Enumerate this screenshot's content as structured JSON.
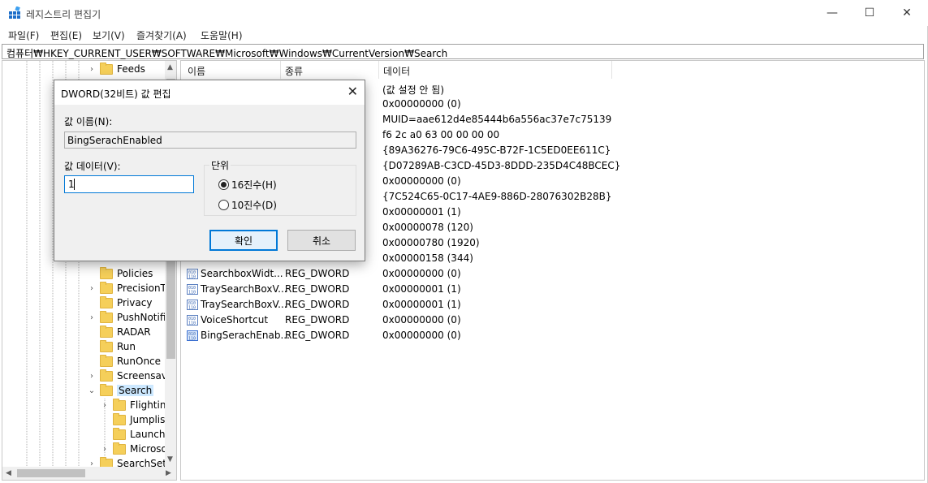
{
  "window": {
    "title": "레지스트리 편집기",
    "controls": {
      "minimize": "—",
      "maximize": "☐",
      "close": "✕"
    }
  },
  "menu": [
    "파일(F)",
    "편집(E)",
    "보기(V)",
    "즐겨찾기(A)",
    "도움말(H)"
  ],
  "address": "컴퓨터₩HKEY_CURRENT_USER₩SOFTWARE₩Microsoft₩Windows₩CurrentVersion₩Search",
  "tree": {
    "items": [
      {
        "label": "Feeds",
        "expander": "›"
      },
      {
        "label": "Policies",
        "expander": ""
      },
      {
        "label": "PrecisionTc",
        "expander": "›"
      },
      {
        "label": "Privacy",
        "expander": ""
      },
      {
        "label": "PushNotific",
        "expander": "›"
      },
      {
        "label": "RADAR",
        "expander": ""
      },
      {
        "label": "Run",
        "expander": ""
      },
      {
        "label": "RunOnce",
        "expander": ""
      },
      {
        "label": "Screensave",
        "expander": "›"
      },
      {
        "label": "Search",
        "expander": "⌄"
      },
      {
        "label": "Flighting",
        "expander": "›"
      },
      {
        "label": "Jumplist",
        "expander": ""
      },
      {
        "label": "Launch",
        "expander": ""
      },
      {
        "label": "Microso",
        "expander": "›"
      },
      {
        "label": "SearchSetti",
        "expander": "›"
      }
    ]
  },
  "list": {
    "headers": {
      "name": "이름",
      "type": "종류",
      "data": "데이터"
    },
    "data_only_rows": [
      "(값 설정 안 됨)",
      "0x00000000 (0)",
      "MUID=aae612d4e85444b6a556ac37e7c75139",
      "f6 2c a0 63 00 00 00 00",
      "{89A36276-79C6-495C-B72F-1C5ED0EE611C}",
      "{D07289AB-C3CD-45D3-8DDD-235D4C48BCEC}",
      "0x00000000 (0)",
      "{7C524C65-0C17-4AE9-886D-28076302B28B}",
      "0x00000001 (1)",
      "0x00000078 (120)",
      "0x00000780 (1920)",
      "0x00000158 (344)"
    ],
    "rows": [
      {
        "name": "SearchboxWidt...",
        "type": "REG_DWORD",
        "data": "0x00000000 (0)"
      },
      {
        "name": "TraySearchBoxV...",
        "type": "REG_DWORD",
        "data": "0x00000001 (1)"
      },
      {
        "name": "TraySearchBoxV...",
        "type": "REG_DWORD",
        "data": "0x00000001 (1)"
      },
      {
        "name": "VoiceShortcut",
        "type": "REG_DWORD",
        "data": "0x00000000 (0)"
      },
      {
        "name": "BingSerachEnab...",
        "type": "REG_DWORD",
        "data": "0x00000000 (0)"
      }
    ]
  },
  "dialog": {
    "title": "DWORD(32비트) 값 편집",
    "value_name_label": "값 이름(N):",
    "value_name": "BingSerachEnabled",
    "value_data_label": "값 데이터(V):",
    "value_data": "1",
    "base_label": "단위",
    "radio_hex": "16진수(H)",
    "radio_dec": "10진수(D)",
    "selected_base": "hex",
    "ok": "확인",
    "cancel": "취소",
    "close": "✕"
  },
  "colors": {
    "accent": "#0078d7",
    "folder": "#f5cf5a",
    "selection": "#cce8ff"
  }
}
